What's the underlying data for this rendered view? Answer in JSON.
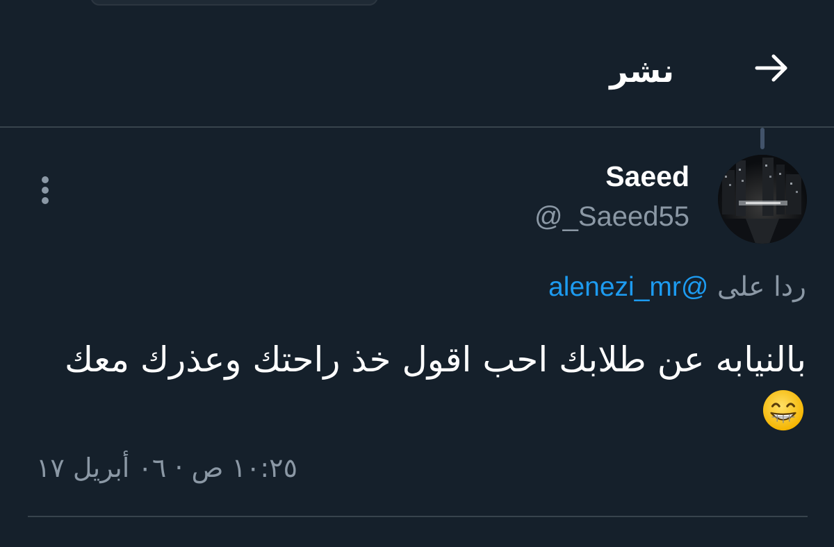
{
  "header": {
    "title": "نشر",
    "back_icon": "arrow-right-icon"
  },
  "tweet": {
    "display_name": "Saeed",
    "handle": "@_Saeed55",
    "reply_prefix": "ردا على ",
    "reply_mention": "@alenezi_mr",
    "text": "بالنيابه عن طلابك احب اقول خذ راحتك وعذرك معك",
    "emoji": "grinning-face-with-smiling-eyes",
    "timestamp": "١٠:٢٥ ص · ٠٦ أبريل ١٧"
  },
  "colors": {
    "background": "#15202b",
    "divider": "#38444d",
    "secondary_text": "#8b98a5",
    "link": "#1d9bf0"
  }
}
